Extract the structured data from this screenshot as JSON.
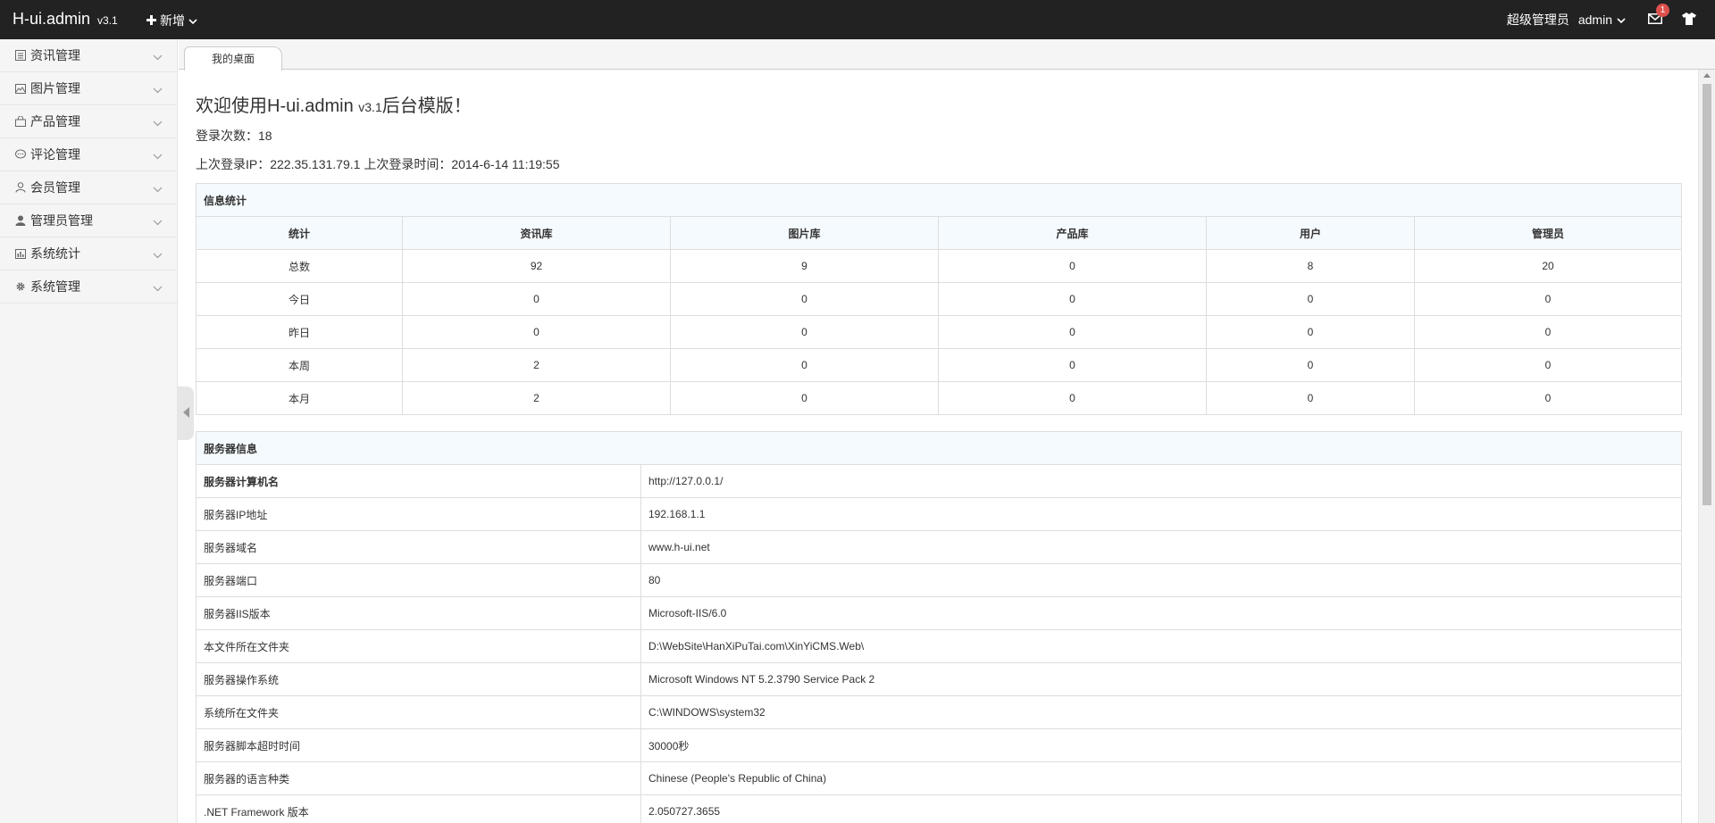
{
  "navbar": {
    "logo": "H-ui.admin",
    "version": "v3.1",
    "new_label": "新增",
    "role": "超级管理员",
    "user": "admin",
    "mail_badge": "1"
  },
  "sidebar": {
    "items": [
      {
        "label": "资讯管理",
        "icon": "news-icon"
      },
      {
        "label": "图片管理",
        "icon": "picture-icon"
      },
      {
        "label": "产品管理",
        "icon": "bag-icon"
      },
      {
        "label": "评论管理",
        "icon": "comment-icon"
      },
      {
        "label": "会员管理",
        "icon": "user-icon"
      },
      {
        "label": "管理员管理",
        "icon": "admin-icon"
      },
      {
        "label": "系统统计",
        "icon": "chart-icon"
      },
      {
        "label": "系统管理",
        "icon": "gear-icon"
      }
    ]
  },
  "tabs": {
    "active": "我的桌面"
  },
  "welcome": {
    "prefix": "欢迎使用H-ui.admin",
    "version": "v3.1",
    "suffix": "后台模版！",
    "login_count": "登录次数：18",
    "last_login": "上次登录IP：222.35.131.79.1 上次登录时间：2014-6-14 11:19:55"
  },
  "stats": {
    "title": "信息统计",
    "headers": [
      "统计",
      "资讯库",
      "图片库",
      "产品库",
      "用户",
      "管理员"
    ],
    "rows": [
      [
        "总数",
        "92",
        "9",
        "0",
        "8",
        "20"
      ],
      [
        "今日",
        "0",
        "0",
        "0",
        "0",
        "0"
      ],
      [
        "昨日",
        "0",
        "0",
        "0",
        "0",
        "0"
      ],
      [
        "本周",
        "2",
        "0",
        "0",
        "0",
        "0"
      ],
      [
        "本月",
        "2",
        "0",
        "0",
        "0",
        "0"
      ]
    ]
  },
  "server": {
    "title": "服务器信息",
    "rows": [
      [
        "服务器计算机名",
        "http://127.0.0.1/"
      ],
      [
        "服务器IP地址",
        "192.168.1.1"
      ],
      [
        "服务器域名",
        "www.h-ui.net"
      ],
      [
        "服务器端口",
        "80"
      ],
      [
        "服务器IIS版本",
        "Microsoft-IIS/6.0"
      ],
      [
        "本文件所在文件夹",
        "D:\\WebSite\\HanXiPuTai.com\\XinYiCMS.Web\\"
      ],
      [
        "服务器操作系统",
        "Microsoft Windows NT 5.2.3790 Service Pack 2"
      ],
      [
        "系统所在文件夹",
        "C:\\WINDOWS\\system32"
      ],
      [
        "服务器脚本超时时间",
        "30000秒"
      ],
      [
        "服务器的语言种类",
        "Chinese (People's Republic of China)"
      ],
      [
        ".NET Framework 版本",
        "2.050727.3655"
      ]
    ]
  }
}
